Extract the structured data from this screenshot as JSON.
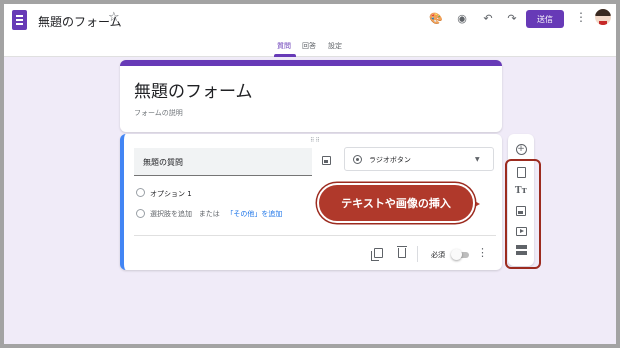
{
  "header": {
    "form_title": "無題のフォーム",
    "send_label": "送信",
    "tabs": [
      "質問",
      "回答",
      "設定"
    ],
    "active_tab": "質問"
  },
  "title_card": {
    "title": "無題のフォーム",
    "description_placeholder": "フォームの説明"
  },
  "question": {
    "title": "無題の質問",
    "type": "ラジオボタン",
    "option1": "オプション 1",
    "add_option": "選択肢を追加",
    "or_text": "または",
    "add_other": "「その他」を追加",
    "required_label": "必須"
  },
  "side_toolbar": {
    "items": [
      "add-question-icon",
      "import-questions-icon",
      "add-title-icon",
      "add-image-icon",
      "add-video-icon",
      "add-section-icon"
    ]
  },
  "annotation": {
    "callout_text": "テキストや画像の挿入"
  },
  "colors": {
    "brand": "#673ab7",
    "focus": "#4285f4",
    "annotation": "#b0392b",
    "background": "#f0ebf8"
  }
}
